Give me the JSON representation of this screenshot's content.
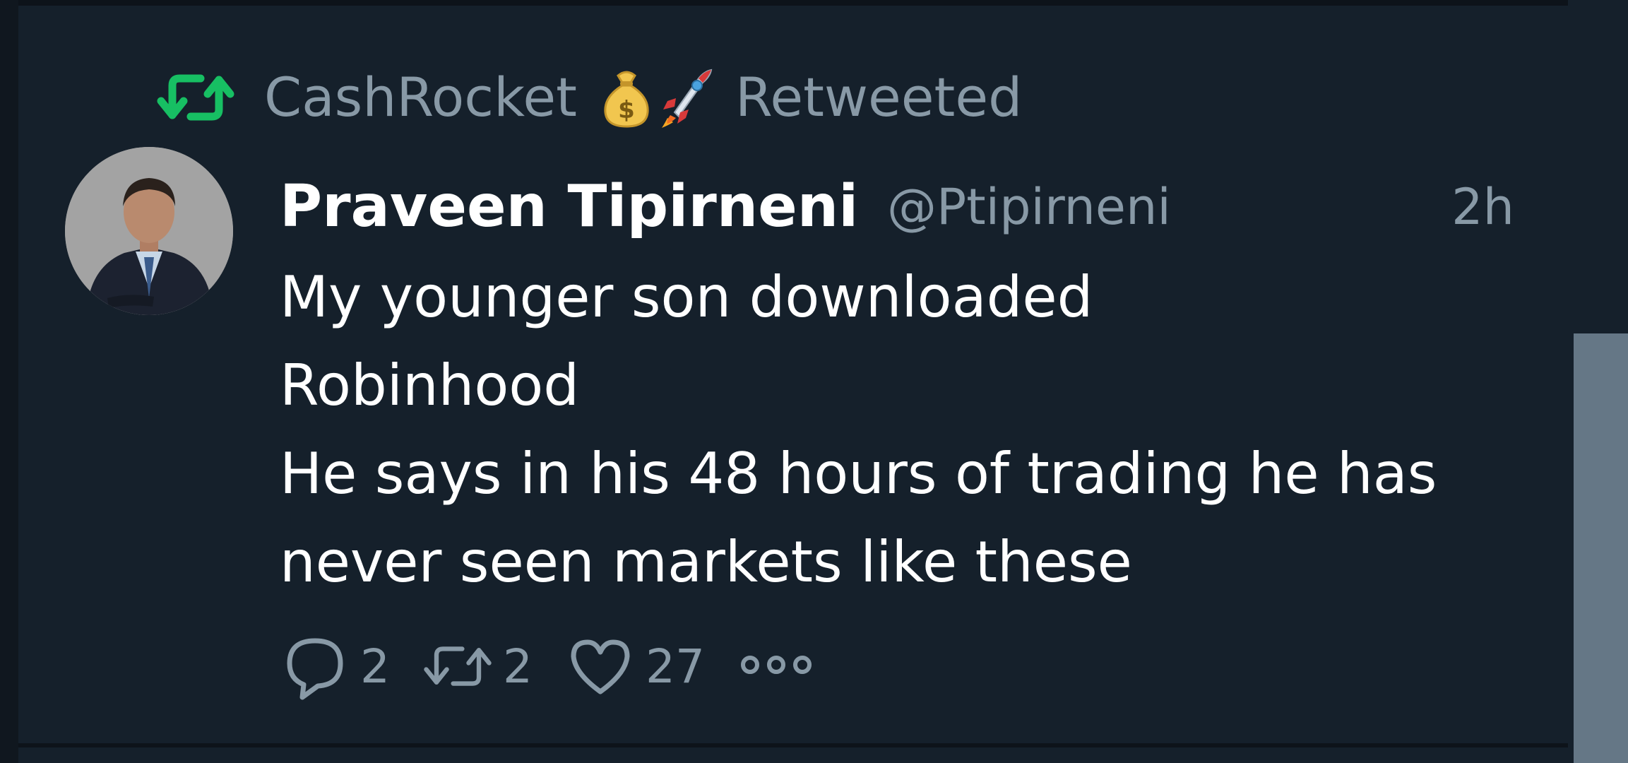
{
  "retweet_context": {
    "user": "CashRocket",
    "emojis": [
      "money-bag-icon",
      "rocket-icon"
    ],
    "label": "Retweeted",
    "accent_color": "#17bf63"
  },
  "tweet": {
    "author_name": "Praveen Tipirneni",
    "author_handle": "@Ptipirneni",
    "timestamp": "2h",
    "text_lines": [
      "My younger son downloaded",
      "Robinhood",
      "He says in his 48 hours of trading he has",
      "never seen markets like these"
    ],
    "reply_count": "2",
    "retweet_count": "2",
    "like_count": "27"
  },
  "colors": {
    "background": "#15202b",
    "muted_text": "#8899a6",
    "primary_text": "#ffffff",
    "scrollbar": "#657786"
  }
}
